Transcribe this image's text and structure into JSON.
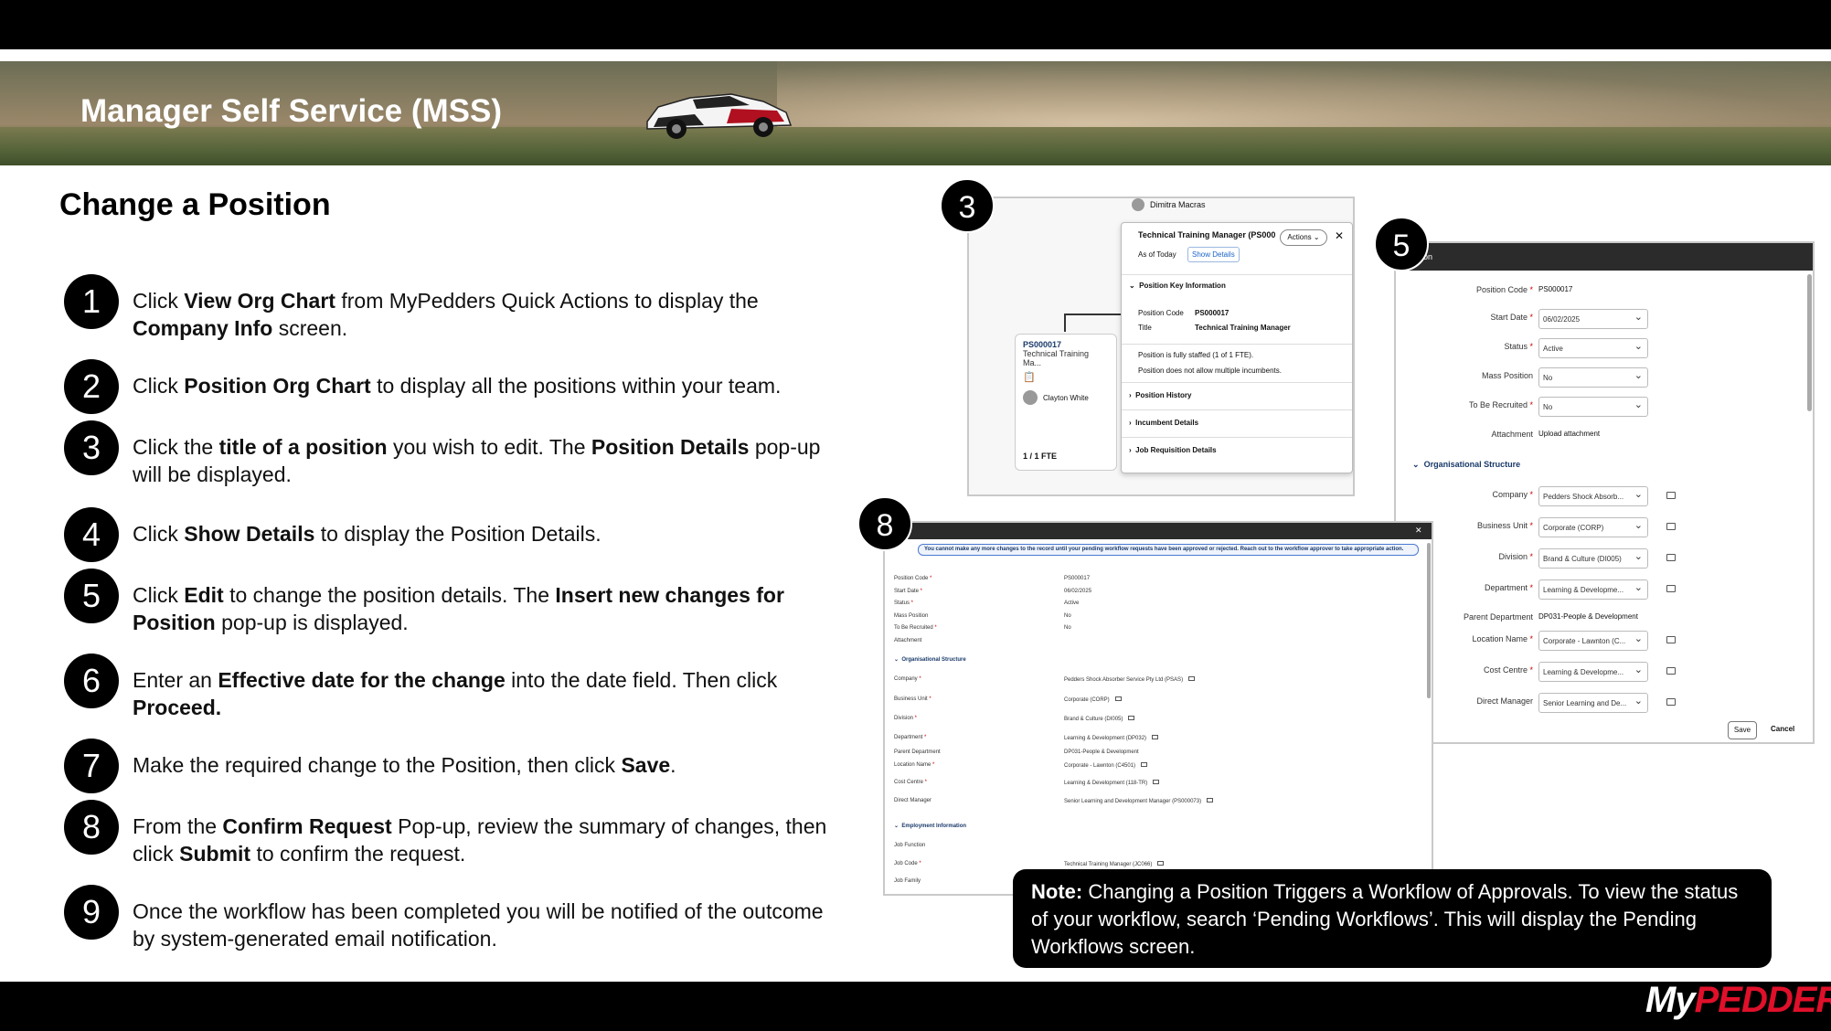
{
  "banner": {
    "title": "Manager Self Service (MSS)"
  },
  "page": {
    "title": "Change a Position"
  },
  "steps": [
    {
      "num": "1",
      "parts": [
        [
          "Click ",
          false
        ],
        [
          "View Org Chart",
          true
        ],
        [
          " from MyPedders Quick Actions to display the ",
          false
        ],
        [
          "Company Info",
          true
        ],
        [
          " screen.",
          false
        ]
      ]
    },
    {
      "num": "2",
      "parts": [
        [
          "Click  ",
          false
        ],
        [
          "Position Org Chart",
          true
        ],
        [
          " to display all the positions within your team.",
          false
        ]
      ]
    },
    {
      "num": "3",
      "parts": [
        [
          "Click the ",
          false
        ],
        [
          "title of a position",
          true
        ],
        [
          " you wish to edit. The ",
          false
        ],
        [
          "Position Details",
          true
        ],
        [
          " pop-up will be displayed.",
          false
        ]
      ]
    },
    {
      "num": "4",
      "parts": [
        [
          "Click ",
          false
        ],
        [
          "Show Details",
          true
        ],
        [
          " to display the Position Details.",
          false
        ]
      ]
    },
    {
      "num": "5",
      "parts": [
        [
          "Click ",
          false
        ],
        [
          "Edit",
          true
        ],
        [
          " to change the position details. The ",
          false
        ],
        [
          "Insert new changes for Position",
          true
        ],
        [
          " pop-up is displayed.",
          false
        ]
      ]
    },
    {
      "num": "6",
      "parts": [
        [
          "Enter an ",
          false
        ],
        [
          "Effective date for the change",
          true
        ],
        [
          " into the date field. Then click ",
          false
        ],
        [
          "Proceed.",
          true
        ]
      ]
    },
    {
      "num": "7",
      "parts": [
        [
          "Make the required change to the Position, then click ",
          false
        ],
        [
          "Save",
          true
        ],
        [
          ".",
          false
        ]
      ]
    },
    {
      "num": "8",
      "parts": [
        [
          "From the ",
          false
        ],
        [
          "Confirm Request",
          true
        ],
        [
          " Pop-up, review the summary of changes, then click ",
          false
        ],
        [
          "Submit",
          true
        ],
        [
          " to confirm the request.",
          false
        ]
      ]
    },
    {
      "num": "9",
      "parts": [
        [
          "Once the workflow has been completed you will be notified of the outcome by system-generated email notification.",
          false
        ]
      ]
    }
  ],
  "shot3": {
    "badge": "3",
    "person_top": "Dimitra Macras",
    "card_code": "PS000017",
    "card_title": "Technical Training Ma...",
    "card_person": "Clayton White",
    "card_fte": "1 / 1 FTE",
    "popup_title": "Technical Training Manager (PS000...",
    "actions": "Actions",
    "as_of": "As of Today",
    "show_details": "Show Details",
    "key_info": "Position Key Information",
    "code_label": "Position Code",
    "code_value": "PS000017",
    "title_label": "Title",
    "title_value": "Technical Training Manager",
    "staffed": "Position is fully staffed (1 of 1 FTE).",
    "multi": "Position does not allow multiple incumbents.",
    "history": "Position History",
    "incumbent": "Incumbent Details",
    "jobreq": "Job Requisition Details"
  },
  "shot5": {
    "badge": "5",
    "header": "on",
    "fields": [
      {
        "label": "Position Code",
        "req": true,
        "value": "PS000017",
        "kind": "text"
      },
      {
        "label": "Start Date",
        "req": true,
        "value": "06/02/2025",
        "kind": "date"
      },
      {
        "label": "Status",
        "req": true,
        "value": "Active",
        "kind": "select"
      },
      {
        "label": "Mass Position",
        "req": false,
        "value": "No",
        "kind": "select"
      },
      {
        "label": "To Be Recruited",
        "req": true,
        "value": "No",
        "kind": "select"
      },
      {
        "label": "Attachment",
        "req": false,
        "value": "Upload attachment",
        "kind": "text"
      }
    ],
    "section": "Organisational Structure",
    "org_fields": [
      {
        "label": "Company",
        "req": true,
        "value": "Pedders Shock Absorb...",
        "kind": "select"
      },
      {
        "label": "Business Unit",
        "req": true,
        "value": "Corporate (CORP)",
        "kind": "select"
      },
      {
        "label": "Division",
        "req": true,
        "value": "Brand & Culture (DI005)",
        "kind": "select"
      },
      {
        "label": "Department",
        "req": true,
        "value": "Learning & Developme...",
        "kind": "select"
      },
      {
        "label": "Parent Department",
        "req": false,
        "value": "DP031-People & Development",
        "kind": "text"
      },
      {
        "label": "Location Name",
        "req": true,
        "value": "Corporate - Lawnton (C...",
        "kind": "select"
      },
      {
        "label": "Cost Centre",
        "req": true,
        "value": "Learning & Developme...",
        "kind": "select"
      },
      {
        "label": "Direct Manager",
        "req": false,
        "value": "Senior Learning and De...",
        "kind": "select"
      }
    ],
    "save": "Save",
    "cancel": "Cancel"
  },
  "shot8": {
    "badge": "8",
    "warning": "You cannot make any more changes to the record until your pending workflow requests have been approved or rejected. Reach out to the workflow approver to take appropriate action.",
    "rows": [
      {
        "label": "Position Code",
        "req": true,
        "value": "PS000017"
      },
      {
        "label": "Start Date",
        "req": true,
        "value": "06/02/2025"
      },
      {
        "label": "Status",
        "req": true,
        "value": "Active"
      },
      {
        "label": "Mass Position",
        "req": false,
        "value": "No"
      },
      {
        "label": "To Be Recruited",
        "req": true,
        "value": "No"
      },
      {
        "label": "Attachment",
        "req": false,
        "value": ""
      }
    ],
    "section1": "Organisational Structure",
    "org_rows": [
      {
        "label": "Company",
        "req": true,
        "value": "Pedders Shock Absorber Service Pty Ltd (PSAS)"
      },
      {
        "label": "Business Unit",
        "req": true,
        "value": "Corporate (CORP)"
      },
      {
        "label": "Division",
        "req": true,
        "value": "Brand & Culture (DI005)"
      },
      {
        "label": "Department",
        "req": true,
        "value": "Learning & Development (DP032)"
      },
      {
        "label": "Parent Department",
        "req": false,
        "value": "DP031-People & Development"
      },
      {
        "label": "Location Name",
        "req": true,
        "value": "Corporate - Lawnton (C4501)"
      },
      {
        "label": "Cost Centre",
        "req": true,
        "value": "Learning & Development (118-TR)"
      },
      {
        "label": "Direct Manager",
        "req": false,
        "value": "Senior Learning and Development Manager (PS000073)"
      }
    ],
    "section2": "Employment Information",
    "emp_rows": [
      {
        "label": "Job Function",
        "req": false,
        "value": ""
      },
      {
        "label": "Job Code",
        "req": true,
        "value": "Technical Training Manager (JC066)"
      },
      {
        "label": "Job Family",
        "req": false,
        "value": ""
      }
    ]
  },
  "note": {
    "bold": "Note:",
    "text": " Changing a Position Triggers a Workflow of Approvals. To view the status of your workflow, search ‘Pending Workflows’. This will display the Pending Workflows screen."
  },
  "logo": {
    "my": "My",
    "brand": "PEDDERS"
  },
  "colors": {
    "accent_blue": "#1a63c7",
    "brand_red": "#e0102a",
    "dark": "#000000"
  }
}
